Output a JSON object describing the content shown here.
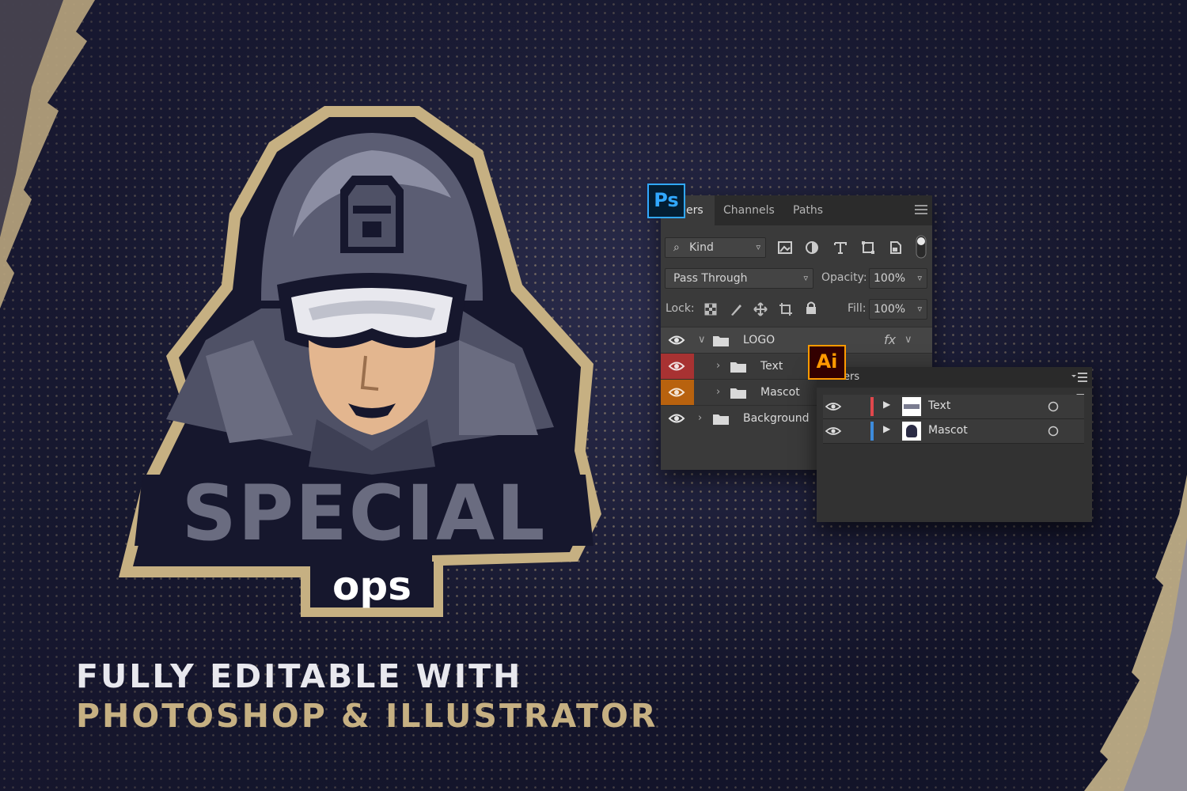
{
  "headline": {
    "line1": "FULLY EDITABLE WITH",
    "line2": "PHOTOSHOP & ILLUSTRATOR"
  },
  "logo": {
    "word1": "SPECIAL",
    "word2": "ops"
  },
  "photoshop": {
    "badge": "Ps",
    "tabs": [
      "ers",
      "Channels",
      "Paths"
    ],
    "filter_label": "Kind",
    "blend_mode": "Pass Through",
    "opacity_label": "Opacity:",
    "opacity_value": "100%",
    "lock_label": "Lock:",
    "fill_label": "Fill:",
    "fill_value": "100%",
    "fx_label": "fx",
    "layers": [
      {
        "name": "LOGO"
      },
      {
        "name": "Text"
      },
      {
        "name": "Mascot"
      },
      {
        "name": "Background"
      }
    ]
  },
  "illustrator": {
    "badge": "Ai",
    "panel_title": "ers",
    "layers": [
      {
        "name": "Text"
      },
      {
        "name": "Mascot"
      }
    ]
  },
  "colors": {
    "background": "#15162c",
    "gold": "#c6b082",
    "gray_fill": "#6a6c80",
    "ps_blue": "#31a8ff",
    "ai_orange": "#ff9a00",
    "layer_red": "#a83232",
    "layer_orange": "#b8620e",
    "ai_stripe_red": "#e0474c",
    "ai_stripe_blue": "#3d8bdb"
  }
}
